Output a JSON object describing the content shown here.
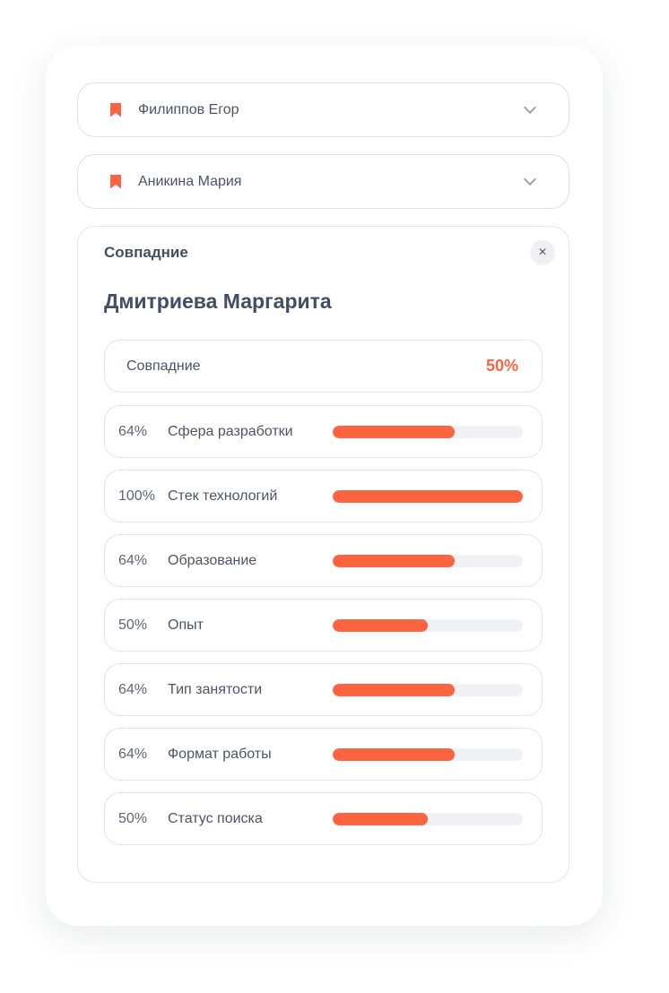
{
  "accent": "#ff6340",
  "candidates": [
    {
      "name": "Филиппов Егор",
      "icon": "bookmark-icon"
    },
    {
      "name": "Аникина Мария",
      "icon": "bookmark-icon"
    }
  ],
  "panel": {
    "title": "Совпадние",
    "close_icon": "×",
    "name": "Дмитриева Маргарита",
    "summary": {
      "label": "Совпадние",
      "value": "50%"
    },
    "criteria": [
      {
        "percent": "64%",
        "label": "Сфера разработки",
        "value": 64
      },
      {
        "percent": "100%",
        "label": "Стек технологий",
        "value": 100
      },
      {
        "percent": "64%",
        "label": "Образование",
        "value": 64
      },
      {
        "percent": "50%",
        "label": "Опыт",
        "value": 50
      },
      {
        "percent": "64%",
        "label": "Тип занятости",
        "value": 64
      },
      {
        "percent": "64%",
        "label": "Формат работы",
        "value": 64
      },
      {
        "percent": "50%",
        "label": "Статус поиска",
        "value": 50
      }
    ]
  }
}
